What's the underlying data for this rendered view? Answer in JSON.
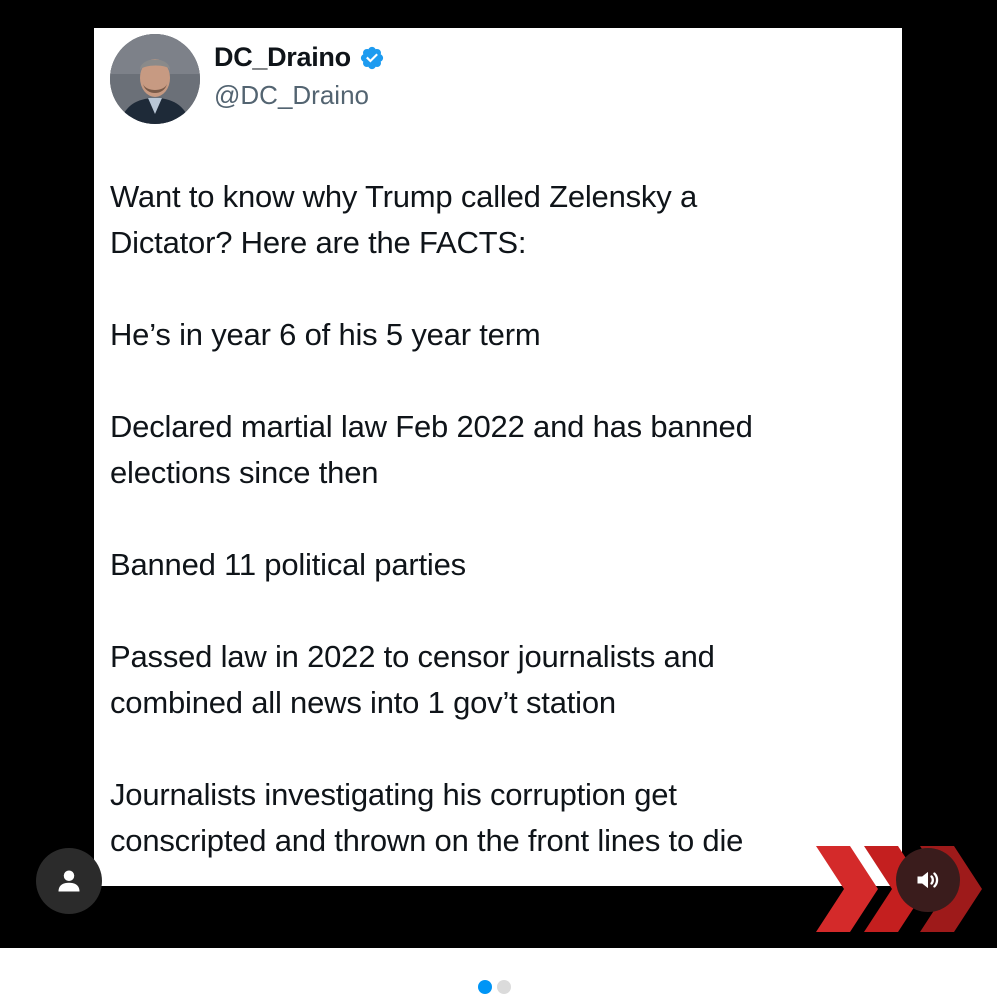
{
  "tweet": {
    "display_name": "DC_Draino",
    "handle": "@DC_Draino",
    "paragraphs": [
      {
        "lines": [
          "Want to know why Trump called Zelensky a",
          "Dictator? Here are the FACTS:"
        ]
      },
      {
        "lines": [
          "He’s in year 6 of his 5 year term"
        ]
      },
      {
        "lines": [
          "Declared martial law Feb 2022 and has banned",
          "elections since then"
        ]
      },
      {
        "lines": [
          "Banned 11 political parties"
        ]
      },
      {
        "lines": [
          "Passed law in 2022 to censor journalists and",
          "combined all news into 1 gov’t station"
        ]
      },
      {
        "lines": [
          "Journalists investigating his corruption get",
          "conscripted and thrown on the front lines to die"
        ]
      }
    ]
  },
  "icons": {
    "avatar": "profile-photo",
    "verified": "verified-badge-icon",
    "user": "user-icon",
    "sound": "speaker-icon",
    "chevrons": "red-chevrons-graphic"
  },
  "carousel": {
    "total": 2,
    "active_index": 0
  },
  "colors": {
    "verified_blue": "#1d9bf0",
    "active_dot": "#0095f6",
    "inactive_dot": "#dbdbdb",
    "chevron_red": "#d42a2a"
  }
}
